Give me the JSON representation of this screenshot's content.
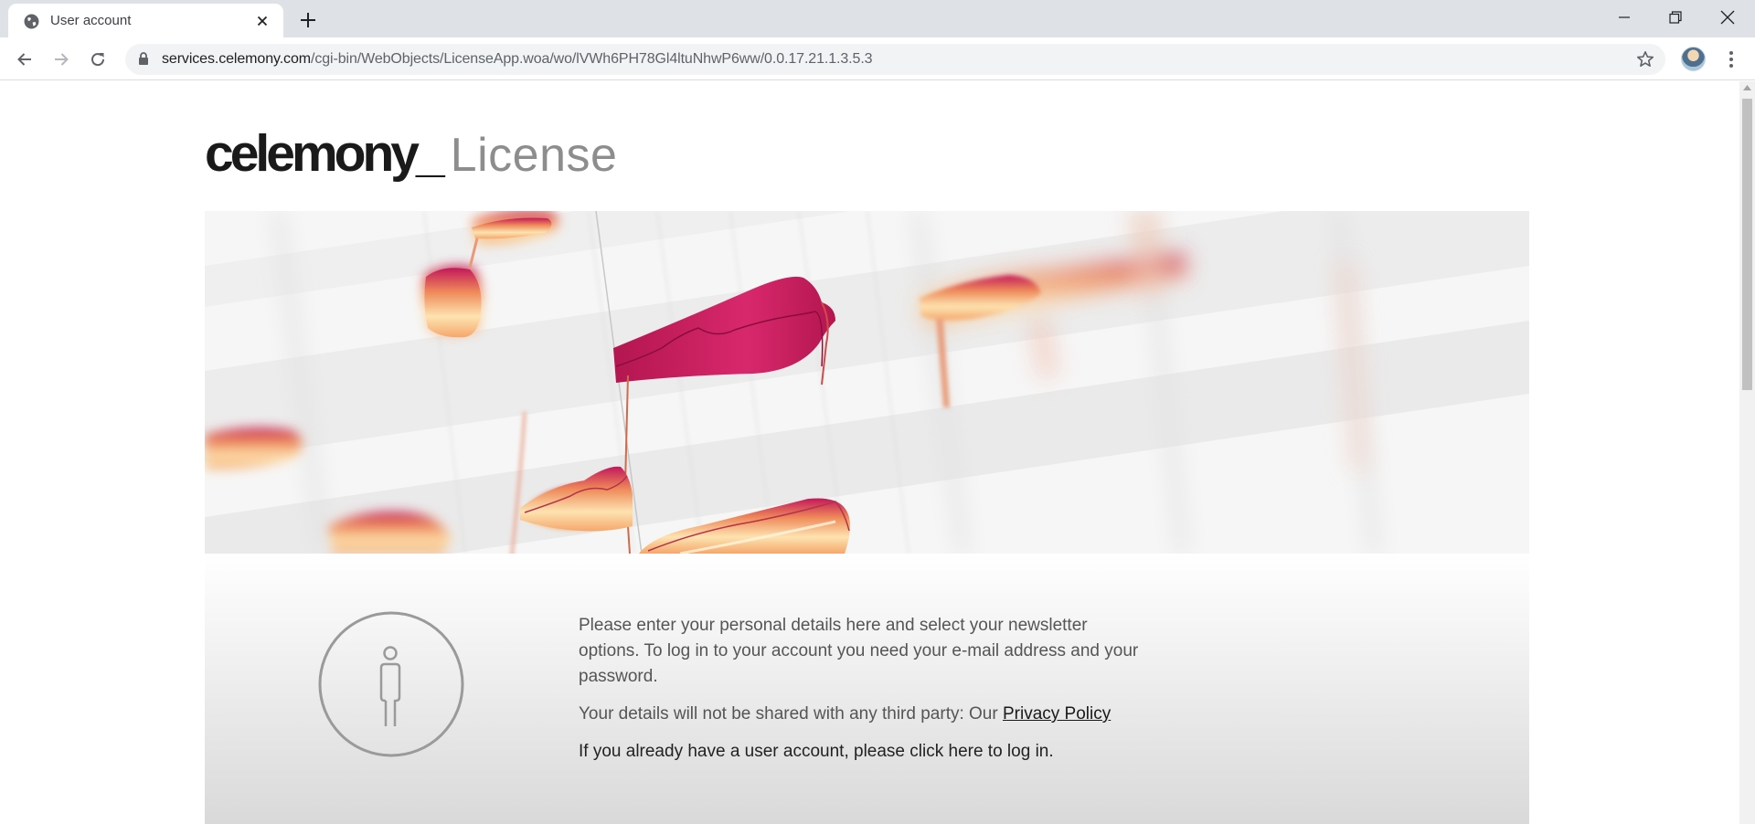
{
  "browser": {
    "tab_title": "User account",
    "url_host": "services.celemony.com",
    "url_path": "/cgi-bin/WebObjects/LicenseApp.woa/wo/lVWh6PH78Gl4ltuNhwP6ww/0.0.17.21.1.3.5.3",
    "icons": [
      "globe-icon",
      "close-icon",
      "plus-icon",
      "minimize-icon",
      "restore-icon",
      "window-close-icon",
      "back-icon",
      "forward-icon",
      "reload-icon",
      "lock-icon",
      "star-icon",
      "kebab-menu-icon"
    ]
  },
  "page": {
    "logo_brand": "celemony",
    "logo_underscore": "_",
    "logo_product": "License",
    "info": {
      "paragraph1": "Please enter your personal details here and select your newsletter options. To log in to your account you need your e-mail address and your password.",
      "paragraph2_prefix": "Your details will not be shared with any third party: Our ",
      "privacy_link": "Privacy Policy",
      "paragraph3": "If you already have a user account, please click here to log in."
    },
    "colors": {
      "blob_magenta": "#c2185b",
      "blob_orange": "#f2a65a",
      "blob_cream": "#fbe6b4"
    }
  }
}
